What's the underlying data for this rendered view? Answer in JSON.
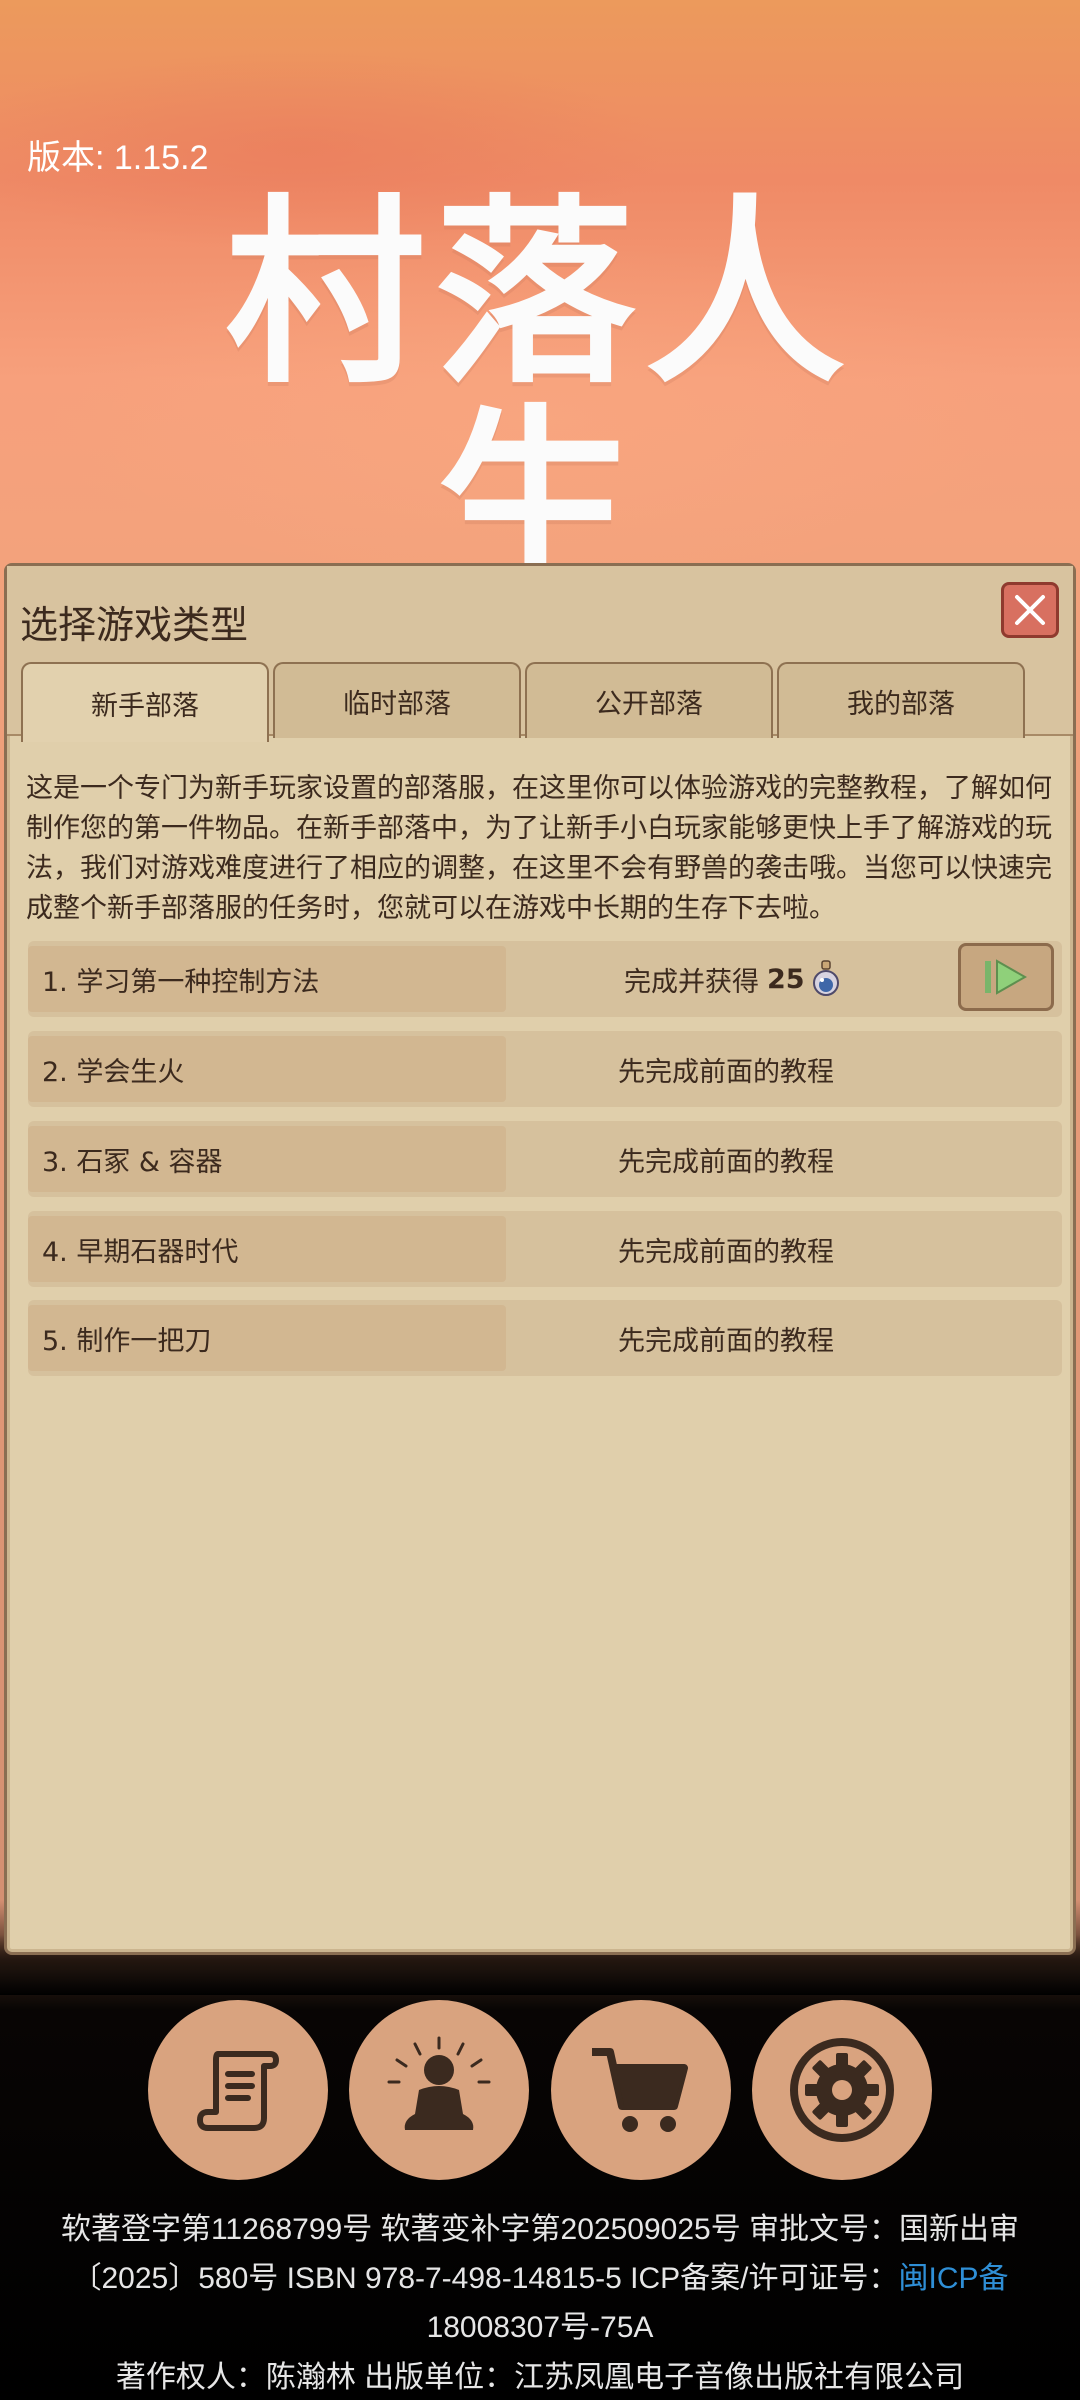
{
  "version_label": "版本: 1.15.2",
  "logo_text": "村落人生",
  "panel": {
    "title": "选择游戏类型",
    "tabs": [
      "新手部落",
      "临时部落",
      "公开部落",
      "我的部落"
    ],
    "description": "这是一个专门为新手玩家设置的部落服，在这里你可以体验游戏的完整教程，了解如何制作您的第一件物品。在新手部落中，为了让新手小白玩家能够更快上手了解游戏的玩法，我们对游戏难度进行了相应的调整，在这里不会有野兽的袭击哦。当您可以快速完成整个新手部落服的任务时，您就可以在游戏中长期的生存下去啦。",
    "tasks": [
      {
        "name": "1. 学习第一种控制方法",
        "status": "完成并获得",
        "reward": "25"
      },
      {
        "name": "2. 学会生火",
        "status": "先完成前面的教程"
      },
      {
        "name": "3. 石冢 & 容器",
        "status": "先完成前面的教程"
      },
      {
        "name": "4. 早期石器时代",
        "status": "先完成前面的教程"
      },
      {
        "name": "5. 制作一把刀",
        "status": "先完成前面的教程"
      }
    ]
  },
  "bottom_buttons": [
    {
      "icon": "scroll-icon"
    },
    {
      "icon": "meditation-icon"
    },
    {
      "icon": "cart-icon"
    },
    {
      "icon": "gear-icon"
    }
  ],
  "footer": {
    "line1": "软著登字第11268799号 软著变补字第202509025号 审批文号：国新出审",
    "line2_text": "〔2025〕580号 ISBN 978-7-498-14815-5 ICP备案/许可证号：",
    "line2_link": "闽ICP备",
    "line3_link": "18008307号-75A",
    "line4": "著作权人：陈瀚林 出版单位：江苏凤凰电子音像出版社有限公司"
  },
  "colors": {
    "panel_bg": "#e0cfab",
    "close_button": "#d87060",
    "link": "#2f8fd6",
    "round_button": "#d9a37f"
  }
}
